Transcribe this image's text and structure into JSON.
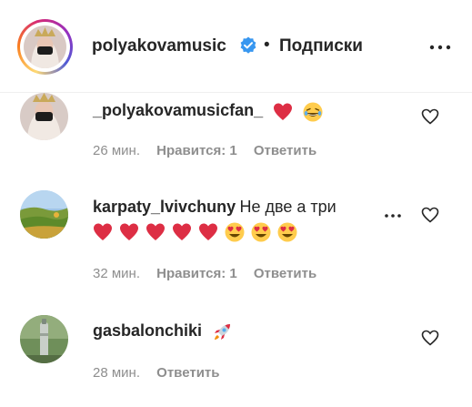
{
  "header": {
    "username": "polyakovamusic",
    "dot": "•",
    "follow_label": "Подписки"
  },
  "comments": [
    {
      "username": "_polyakovamusicfan_",
      "text": "",
      "time": "26 мин.",
      "likes": "Нравится: 1",
      "reply": "Ответить"
    },
    {
      "username": "karpaty_lvivchuny",
      "text": "Не две а три",
      "time": "32 мин.",
      "likes": "Нравится: 1",
      "reply": "Ответить"
    },
    {
      "username": "gasbalonchiki",
      "text": "",
      "time": "28 мин.",
      "reply": "Ответить"
    }
  ],
  "colors": {
    "verified": "#3897f0",
    "heart_emoji": "#e0245e",
    "muted_text": "#8e8e8e"
  }
}
